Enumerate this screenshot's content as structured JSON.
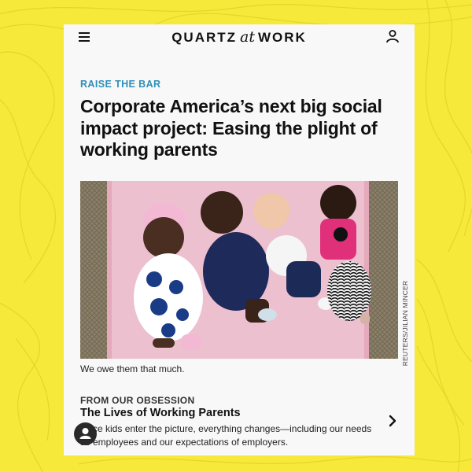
{
  "colors": {
    "page_background": "#f6e93a",
    "card_background": "#f8f8f8",
    "kicker": "#2f8fb8",
    "text": "#111111"
  },
  "header": {
    "logo_left": "QUARTZ",
    "logo_at": "at",
    "logo_right": "WORK",
    "menu_icon": "hamburger-menu-icon",
    "account_icon": "user-account-icon"
  },
  "article": {
    "kicker": "RAISE THE BAR",
    "headline": "Corporate America’s next big social impact project: Easing the plight of working parents",
    "image": {
      "description": "four babies lying side by side on a pink blanket",
      "credit": "REUTERS/JILIAN MINCER"
    },
    "caption": "We owe them that much."
  },
  "obsession": {
    "label": "FROM OUR OBSESSION",
    "title": "The Lives of Working Parents",
    "description": "Once kids enter the picture, everything changes—including our needs as employees and our expectations of employers.",
    "chevron_icon": "chevron-right-icon"
  },
  "floating_button": {
    "icon": "person-icon"
  }
}
